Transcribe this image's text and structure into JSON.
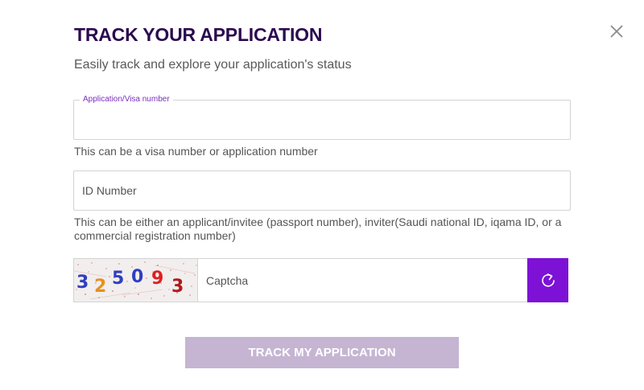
{
  "modal": {
    "title": "TRACK YOUR APPLICATION",
    "subtitle": "Easily track and explore your application's status",
    "close_icon": "close-icon"
  },
  "visa_field": {
    "label": "Application/Visa number",
    "value": "",
    "helper": "This can be a visa number or application number"
  },
  "id_field": {
    "placeholder": "ID Number",
    "value": "",
    "helper": "This can be either an applicant/invitee (passport number), inviter(Saudi national ID, iqama ID, or a commercial registration number)"
  },
  "captcha": {
    "image_text": [
      "3",
      "2",
      "5",
      "0",
      "9",
      "3"
    ],
    "placeholder": "Captcha",
    "value": "",
    "refresh_icon": "refresh-icon"
  },
  "submit": {
    "label": "TRACK MY APPLICATION"
  },
  "colors": {
    "title": "#2b0a4f",
    "accent": "#7d12d6",
    "button_disabled": "#c5b5d2"
  }
}
